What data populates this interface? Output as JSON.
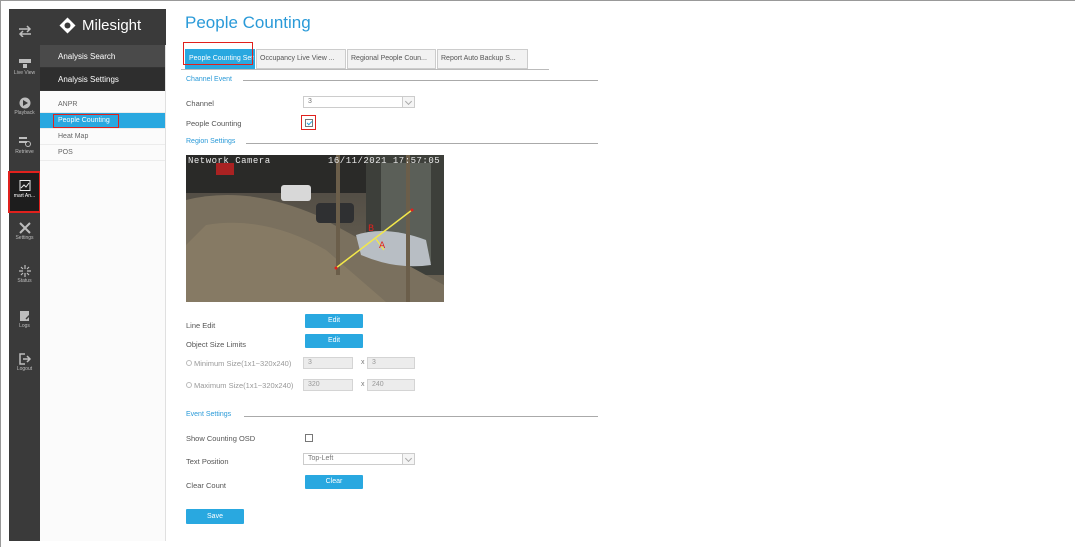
{
  "rail": {
    "items": [
      {
        "id": "menu",
        "label": "",
        "icon": "swap-arrows-icon"
      },
      {
        "id": "live-view",
        "label": "Live View",
        "icon": "live-view-icon"
      },
      {
        "id": "playback",
        "label": "Playback",
        "icon": "playback-icon"
      },
      {
        "id": "retrieve",
        "label": "Retrieve",
        "icon": "retrieve-icon"
      },
      {
        "id": "smart-analysis",
        "label": "mart An...",
        "icon": "smart-analysis-icon"
      },
      {
        "id": "settings",
        "label": "Settings",
        "icon": "settings-tools-icon"
      },
      {
        "id": "status",
        "label": "Status",
        "icon": "status-icon"
      },
      {
        "id": "logs",
        "label": "Logs",
        "icon": "logs-icon"
      },
      {
        "id": "logout",
        "label": "Logout",
        "icon": "logout-icon"
      }
    ]
  },
  "logo": {
    "text": "Milesight"
  },
  "menu": {
    "group1": "Analysis Search",
    "group2": "Analysis Settings",
    "items": [
      "ANPR",
      "People Counting",
      "Heat Map",
      "POS"
    ]
  },
  "page": {
    "title": "People Counting"
  },
  "tabs": [
    "People Counting Setti",
    "Occupancy Live View ...",
    "Regional People Coun...",
    "Report Auto Backup S..."
  ],
  "channel_event": {
    "section": "Channel Event",
    "channel_label": "Channel",
    "channel_value": "3",
    "people_counting_label": "People Counting",
    "people_counting_checked": true
  },
  "region": {
    "section": "Region Settings",
    "osd_name": "Network Camera",
    "osd_time": "16/11/2021 17:57:05",
    "line_labels": [
      "B",
      "A"
    ],
    "line_edit_label": "Line Edit",
    "line_edit_button": "Edit",
    "object_size_label": "Object Size Limits",
    "object_size_button": "Edit",
    "min_label": "Minimum Size(1x1~320x240)",
    "min_w": "3",
    "min_h": "3",
    "max_label": "Maximum Size(1x1~320x240)",
    "max_w": "320",
    "max_h": "240",
    "times": "x"
  },
  "event": {
    "section": "Event Settings",
    "show_osd_label": "Show Counting OSD",
    "show_osd_checked": false,
    "text_pos_label": "Text Position",
    "text_pos_value": "Top-Left",
    "clear_label": "Clear Count",
    "clear_button": "Clear"
  },
  "save_button": "Save",
  "colors": {
    "accent": "#29a8e0",
    "highlight": "#e0211d",
    "rail": "#3a3a3a"
  }
}
